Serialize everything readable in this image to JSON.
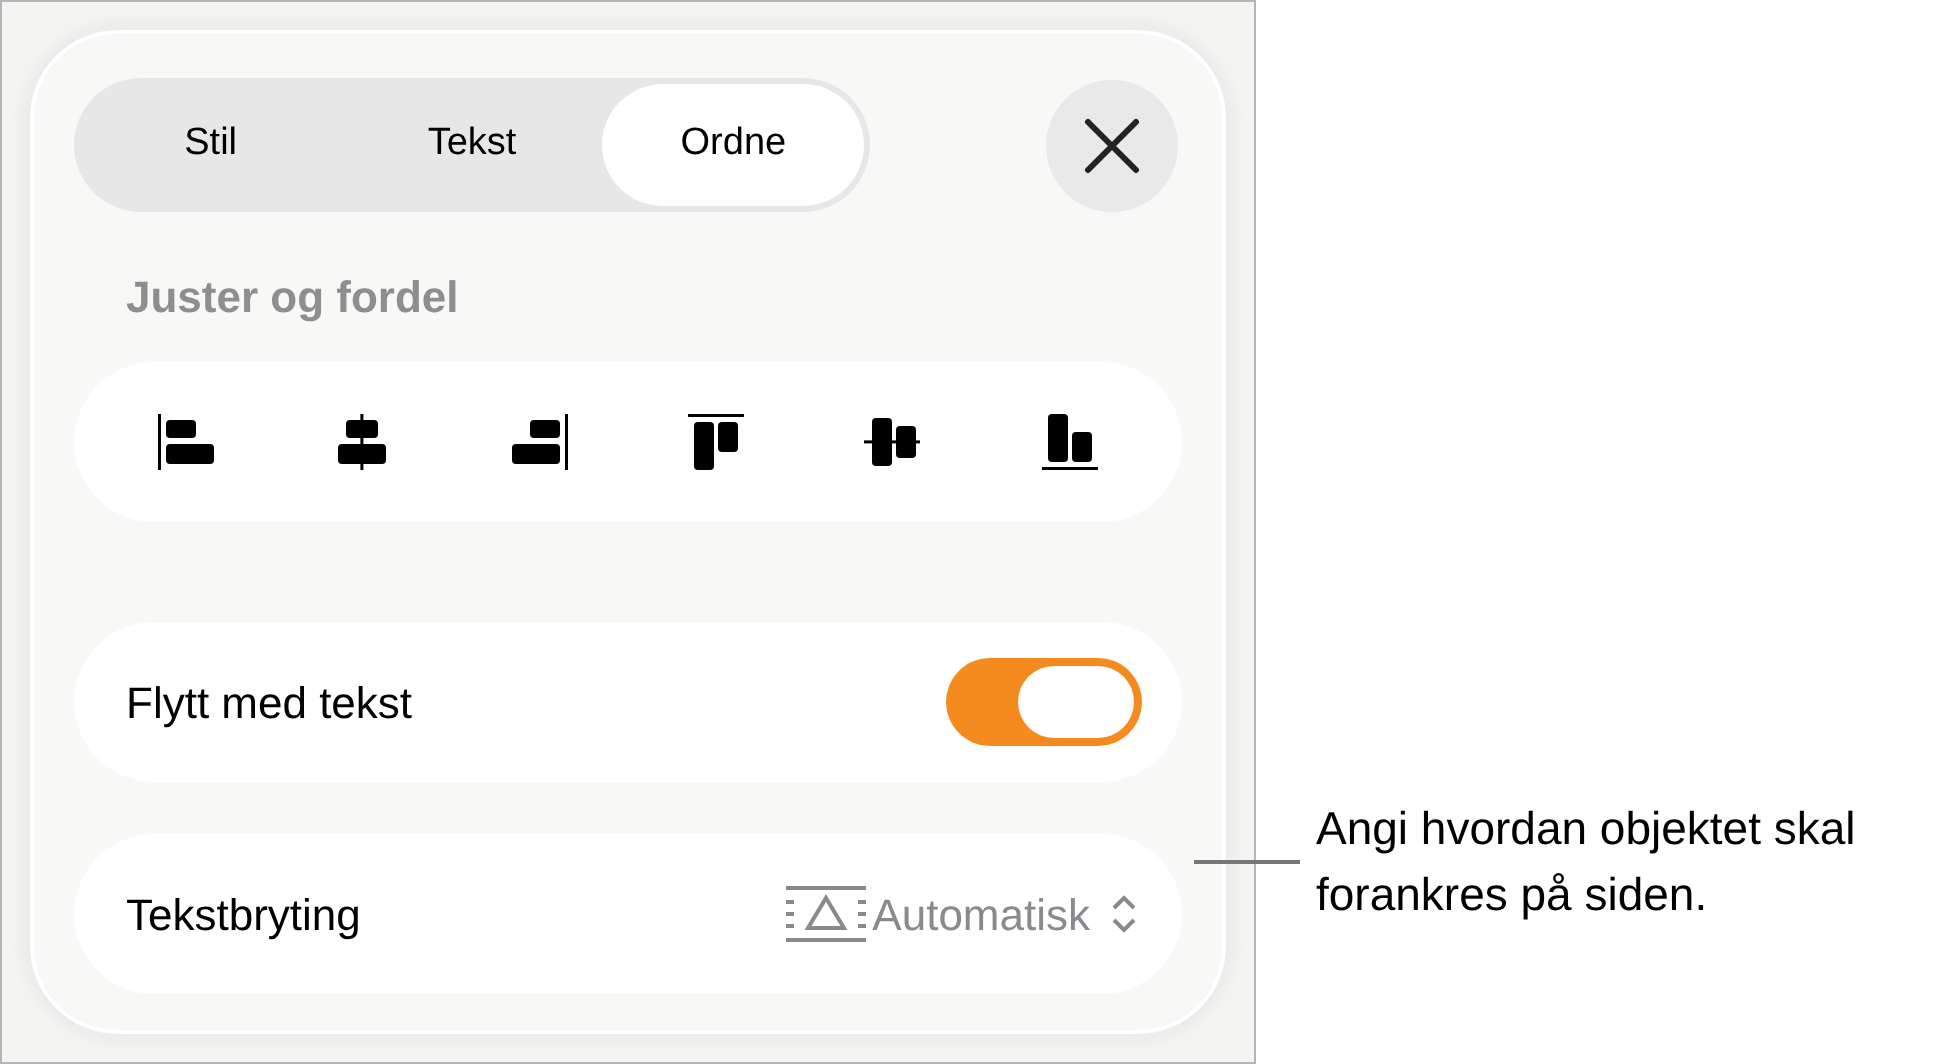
{
  "tabs": [
    {
      "label": "Stil",
      "selected": false
    },
    {
      "label": "Tekst",
      "selected": false
    },
    {
      "label": "Ordne",
      "selected": true
    }
  ],
  "section_heading": "Juster og fordel",
  "align_buttons": [
    {
      "kind": "left"
    },
    {
      "kind": "center"
    },
    {
      "kind": "right"
    },
    {
      "kind": "top"
    },
    {
      "kind": "middle"
    },
    {
      "kind": "bottom"
    }
  ],
  "move_with_text": {
    "label": "Flytt med tekst",
    "on": true
  },
  "text_wrap": {
    "label": "Tekstbryting",
    "value": "Automatisk"
  },
  "callout": "Angi hvordan objektet skal forankres på siden."
}
